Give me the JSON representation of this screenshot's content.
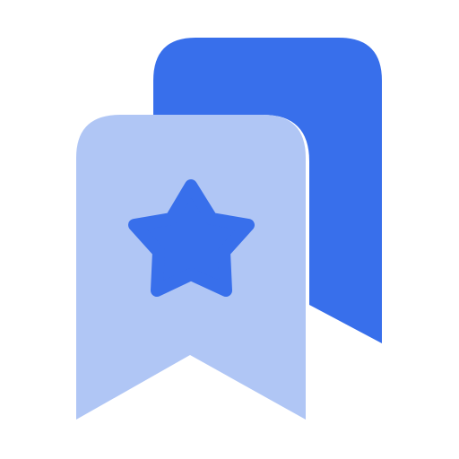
{
  "icon": {
    "name": "bookmarks-star-icon",
    "colors": {
      "back_bookmark": "#386FEB",
      "front_bookmark": "#B0C6F5",
      "star": "#386FEB",
      "background": "#FFFFFF"
    }
  }
}
